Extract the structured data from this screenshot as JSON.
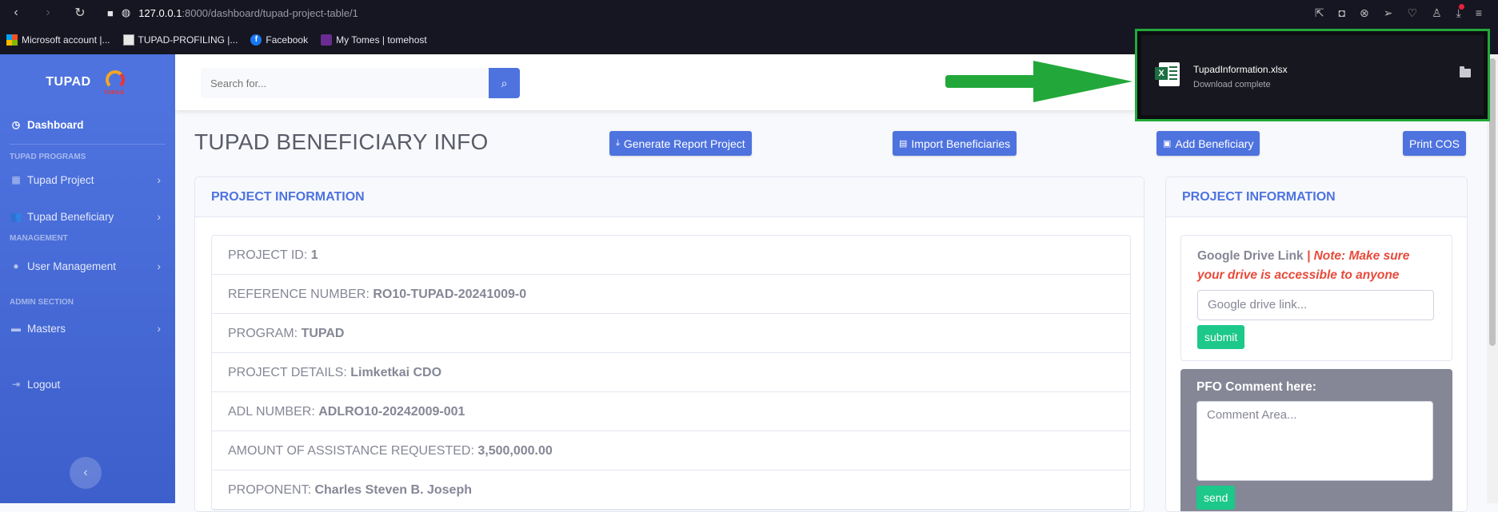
{
  "browser": {
    "url_host": "127.0.0.1",
    "url_path": ":8000/dashboard/tupad-project-table/1",
    "bookmarks": [
      {
        "label": "Microsoft account |...",
        "icon": "microsoft-icon"
      },
      {
        "label": "TUPAD-PROFILING |...",
        "icon": "tupad-icon"
      },
      {
        "label": "Facebook",
        "icon": "facebook-icon"
      },
      {
        "label": "My Tomes | tomehost",
        "icon": "tomehost-icon"
      }
    ]
  },
  "sidebar": {
    "brand": "TUPAD",
    "brand_sub": "TUPAD",
    "dashboard": "Dashboard",
    "heading_programs": "TUPAD PROGRAMS",
    "tupad_project": "Tupad Project",
    "tupad_beneficiary": "Tupad Beneficiary",
    "heading_management": "MANAGEMENT",
    "user_management": "User Management",
    "heading_admin": "ADMIN SECTION",
    "masters": "Masters",
    "logout": "Logout"
  },
  "topbar": {
    "search_placeholder": "Search for..."
  },
  "page": {
    "title": "TUPAD BENEFICIARY INFO",
    "btn_generate": "Generate Report Project",
    "btn_import": "Import Beneficiaries",
    "btn_add": "Add Beneficiary",
    "btn_print": "Print COS"
  },
  "project_card": {
    "header": "PROJECT INFORMATION",
    "rows": [
      {
        "label": "PROJECT ID: ",
        "value": "1"
      },
      {
        "label": "REFERENCE NUMBER: ",
        "value": "RO10-TUPAD-20241009-0"
      },
      {
        "label": "PROGRAM: ",
        "value": "TUPAD"
      },
      {
        "label": "PROJECT DETAILS: ",
        "value": "Limketkai CDO"
      },
      {
        "label": "ADL NUMBER: ",
        "value": "ADLRO10-20242009-001"
      },
      {
        "label": "AMOUNT OF ASSISTANCE REQUESTED: ",
        "value": "3,500,000.00"
      },
      {
        "label": "PROPONENT: ",
        "value": "Charles Steven B. Joseph"
      }
    ]
  },
  "side_card": {
    "header": "PROJECT INFORMATION",
    "gd_label": "Google Drive Link ",
    "gd_note": "| Note: Make sure your drive is accessible to anyone",
    "gd_placeholder": "Google drive link...",
    "submit": "submit",
    "pfo_label": "PFO Comment here:",
    "pfo_placeholder": "Comment Area...",
    "send": "send"
  },
  "download": {
    "filename": "TupadInformation.xlsx",
    "status": "Download complete"
  },
  "colors": {
    "primary": "#4e73df",
    "success": "#1cc88a",
    "danger": "#e74a3b",
    "highlight": "#22a83a"
  }
}
